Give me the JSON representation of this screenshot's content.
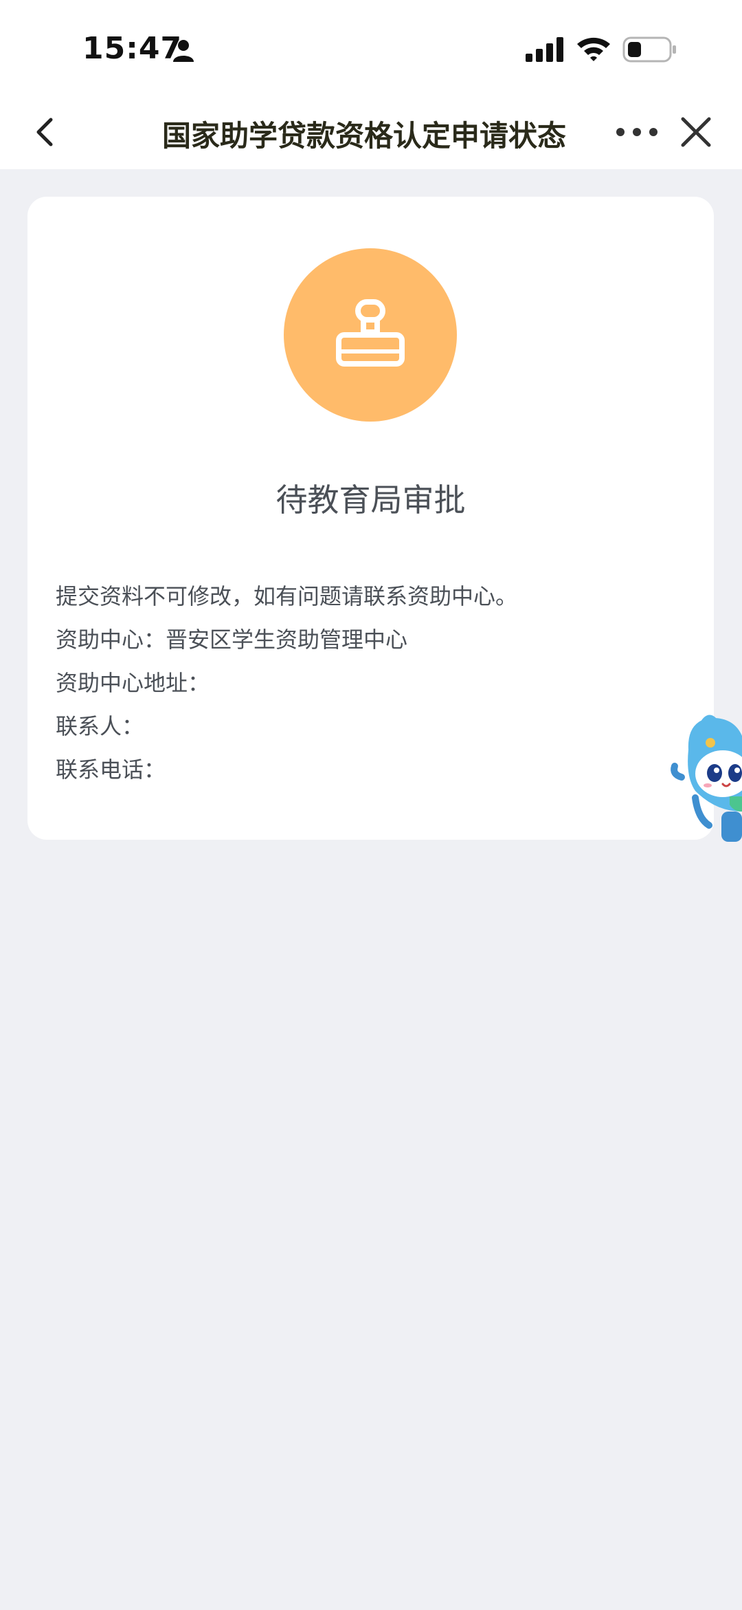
{
  "status_bar": {
    "time": "15:47"
  },
  "nav": {
    "title": "国家助学贷款资格认定申请状态"
  },
  "card": {
    "status_title": "待教育局审批",
    "lines": [
      "提交资料不可修改，如有问题请联系资助中心。",
      "资助中心：晋安区学生资助管理中心",
      "资助中心地址：",
      "联系人：",
      "联系电话："
    ]
  },
  "colors": {
    "page_background": "#eff0f4",
    "status_accent": "#ffbb6a",
    "text": "#4b5057"
  },
  "icons": [
    "person-icon",
    "signal-icon",
    "wifi-icon",
    "battery-icon",
    "back-chevron-icon",
    "more-dots-icon",
    "close-icon",
    "stamp-icon",
    "mascot-icon"
  ]
}
